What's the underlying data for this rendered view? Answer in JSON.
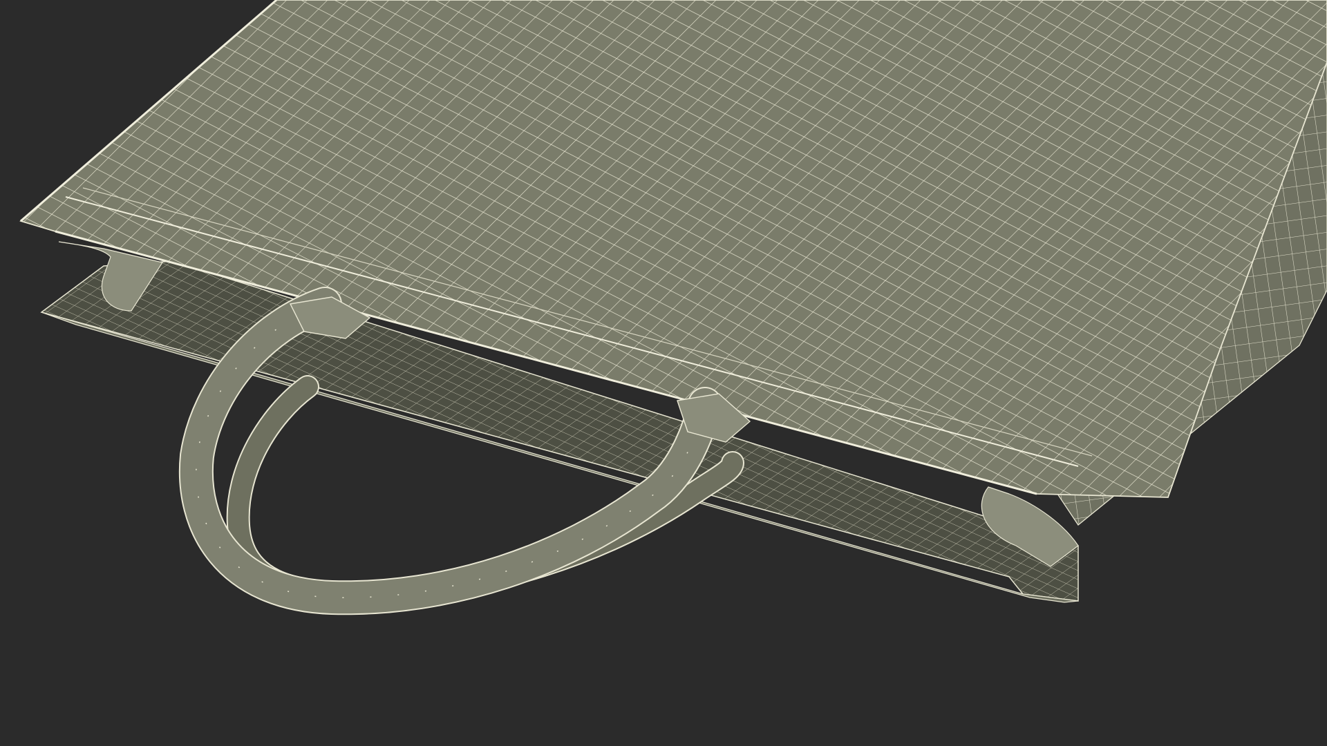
{
  "scene": {
    "subject": "wireframe-paper-shopping-bag",
    "colors": {
      "background": "#2b2b2b",
      "surface": "#7a7c6a",
      "surface_dark": "#55574a",
      "interior": "#4a4c40",
      "wire": "#e8e6d2",
      "handle": "#7f8170"
    }
  }
}
